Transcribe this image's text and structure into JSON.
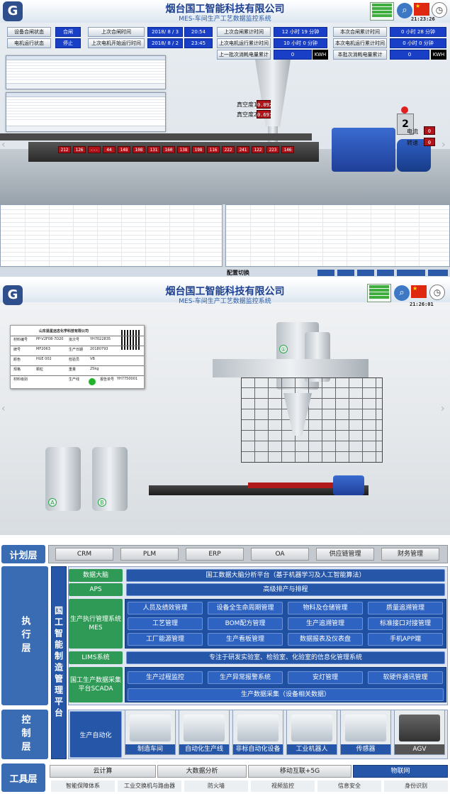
{
  "panel1": {
    "company": "烟台国工智能科技有限公司",
    "subtitle": "MES-车间生产工艺数据监控系统",
    "time": "21:23:26",
    "status": [
      {
        "label": "设备合闸状态",
        "value": "合闸"
      },
      {
        "label": "电机运行状态",
        "value": "停止"
      }
    ],
    "times": [
      {
        "label": "上次合闸时间",
        "date": "2018/ 8 / 3",
        "time": "20:54"
      },
      {
        "label": "上次电机开始运行时间",
        "date": "2018/ 8 / 2",
        "time": "23:45"
      }
    ],
    "cumul": [
      {
        "label": "上次合闸累计时间",
        "value": "12 小时 19 分钟"
      },
      {
        "label": "上次电机运行累计时间",
        "value": "10 小时 0 分钟"
      },
      {
        "label": "上一批次消耗电量累计",
        "value": "0",
        "unit": "KWH"
      }
    ],
    "cumul2": [
      {
        "label": "本次合闸累计时间",
        "value": "0 小时 28 分钟"
      },
      {
        "label": "本次电机运行累计时间",
        "value": "0 小时 0 分钟"
      },
      {
        "label": "本批次消耗电量累计",
        "value": "0",
        "unit": "KWH"
      }
    ],
    "temps": [
      "212",
      "126",
      "---",
      "44",
      "148",
      "108",
      "131",
      "160",
      "138",
      "198",
      "116",
      "222",
      "241",
      "122",
      "223",
      "146"
    ],
    "vacuum": [
      {
        "label": "真空度1",
        "value": "0.092"
      },
      {
        "label": "真空度2",
        "value": "0.691"
      }
    ],
    "motor": [
      {
        "label": "电流",
        "value": "0"
      },
      {
        "label": "转速",
        "value": "0"
      }
    ],
    "station": "2",
    "config_tab": "配置切换"
  },
  "panel2": {
    "company": "烟台国工智能科技有限公司",
    "subtitle": "MES-车间生产工艺数据监控系统",
    "time": "21:26:01",
    "label_card_title": "山东蓝星远志化学科技有限公司",
    "card_rows": [
      {
        "k": "材料编号",
        "v": "PP-V2F08-7D20",
        "k2": "批次号",
        "v2": "YH7022835"
      },
      {
        "k": "牌号",
        "v": "MF2063",
        "k2": "生产日期",
        "v2": "20180793"
      },
      {
        "k": "颜色",
        "v": "HUE 002",
        "k2": "检验员",
        "v2": "VB"
      },
      {
        "k": "规格",
        "v": "颗粒",
        "k2": "重量",
        "v2": "25kg"
      },
      {
        "k": "材料级别",
        "v": "",
        "k2": "生产线",
        "v2": "",
        "k3": "报告单号",
        "v3": "YH7750001"
      }
    ],
    "marker_1": "①",
    "marker_a": "A",
    "marker_b": "B"
  },
  "panel3": {
    "layers": {
      "plan": "计划层",
      "exec": "执行层",
      "control": "控制层",
      "tool": "工具层"
    },
    "plan_items": [
      "CRM",
      "PLM",
      "ERP",
      "OA",
      "供应链管理",
      "财务管理"
    ],
    "platform": "国工智能制造管理平台",
    "big_data": {
      "label": "数据大脑",
      "value": "国工数据大脑分析平台（基于机器学习及人工智能算法）"
    },
    "aps": {
      "label": "APS",
      "value": "高级排产与排程"
    },
    "mes": {
      "label": "生产执行管理系统MES",
      "items": [
        "人员及绩效管理",
        "设备全生命周期管理",
        "物料及仓储管理",
        "质量追溯管理",
        "工艺管理",
        "BOM配方管理",
        "生产追溯管理",
        "标准接口对接管理",
        "工厂能源管理",
        "生产看板管理",
        "数据报表及仪表盘",
        "手机APP端"
      ]
    },
    "lims": {
      "label": "LIMS系统",
      "value": "专注于研发实验室、检验室、化验室的信息化管理系统"
    },
    "scada": {
      "label": "国工生产数据采集平台SCADA",
      "items": [
        "生产过程监控",
        "生产异常报警系统",
        "安灯管理",
        "软硬件通讯管理"
      ],
      "wide": "生产数据采集（设备相关数据）"
    },
    "automation": {
      "label": "生产自动化",
      "devices": [
        "制造车间",
        "自动化生产线",
        "非标自动化设备",
        "工业机器人",
        "传感器",
        "AGV"
      ]
    },
    "tool_row1": [
      "云计算",
      "大数据分析",
      "移动互联+5G",
      "物联网"
    ],
    "tool_row2": [
      "智能保障体系",
      "工业交换机与路由器",
      "防火墙",
      "视频监控",
      "信息安全",
      "身份识别"
    ]
  }
}
